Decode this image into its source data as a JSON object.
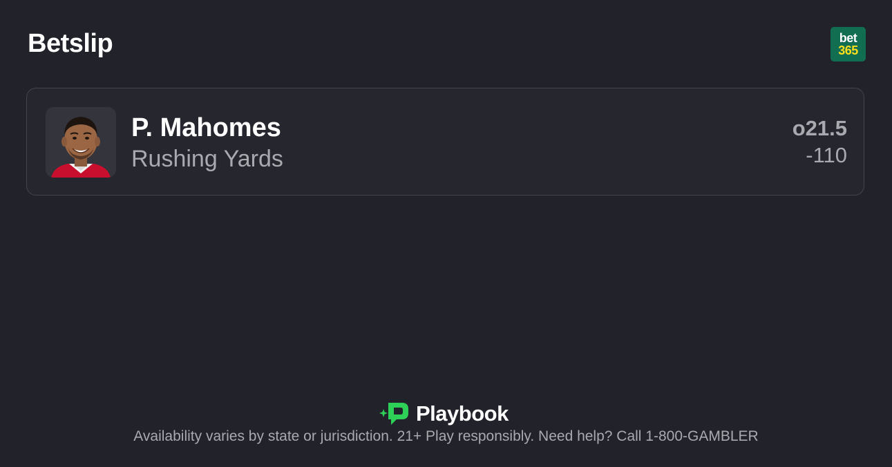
{
  "header": {
    "title": "Betslip",
    "sportsbook": {
      "name": "bet365",
      "logo_line1": "bet",
      "logo_line2": "365",
      "brand_color": "#126e51",
      "accent_color": "#ffdf1b"
    }
  },
  "bet": {
    "player_name": "P. Mahomes",
    "market": "Rushing Yards",
    "line": "o21.5",
    "odds": "-110",
    "avatar": "player-headshot"
  },
  "footer": {
    "logo_text": "Playbook",
    "logo_icon": "playbook-logo-icon",
    "logo_color": "#2ed158",
    "disclaimer": "Availability varies by state or jurisdiction. 21+ Play responsibly. Need help? Call 1-800-GAMBLER"
  },
  "colors": {
    "background": "#22222a",
    "card_background": "#26262e",
    "card_border": "#45454e",
    "muted_text": "#a9a9b0"
  }
}
